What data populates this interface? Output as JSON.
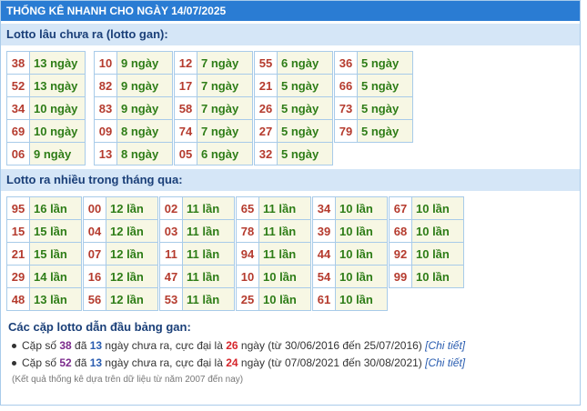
{
  "title": "THỐNG KÊ NHANH CHO NGÀY 14/07/2025",
  "gan": {
    "heading": "Lotto lâu chưa ra (lotto gan):",
    "columns": [
      [
        [
          "38",
          "13 ngày"
        ],
        [
          "52",
          "13 ngày"
        ],
        [
          "34",
          "10 ngày"
        ],
        [
          "69",
          "10 ngày"
        ],
        [
          "06",
          "9 ngày"
        ]
      ],
      [
        [
          "10",
          "9 ngày"
        ],
        [
          "82",
          "9 ngày"
        ],
        [
          "83",
          "9 ngày"
        ],
        [
          "09",
          "8 ngày"
        ],
        [
          "13",
          "8 ngày"
        ]
      ],
      [
        [
          "12",
          "7 ngày"
        ],
        [
          "17",
          "7 ngày"
        ],
        [
          "58",
          "7 ngày"
        ],
        [
          "74",
          "7 ngày"
        ],
        [
          "05",
          "6 ngày"
        ]
      ],
      [
        [
          "55",
          "6 ngày"
        ],
        [
          "21",
          "5 ngày"
        ],
        [
          "26",
          "5 ngày"
        ],
        [
          "27",
          "5 ngày"
        ],
        [
          "32",
          "5 ngày"
        ]
      ],
      [
        [
          "36",
          "5 ngày"
        ],
        [
          "66",
          "5 ngày"
        ],
        [
          "73",
          "5 ngày"
        ],
        [
          "79",
          "5 ngày"
        ]
      ]
    ]
  },
  "frequent": {
    "heading": "Lotto ra nhiều trong tháng qua:",
    "columns": [
      [
        [
          "95",
          "16 lần"
        ],
        [
          "15",
          "15 lần"
        ],
        [
          "21",
          "15 lần"
        ],
        [
          "29",
          "14 lần"
        ],
        [
          "48",
          "13 lần"
        ]
      ],
      [
        [
          "00",
          "12 lần"
        ],
        [
          "04",
          "12 lần"
        ],
        [
          "07",
          "12 lần"
        ],
        [
          "16",
          "12 lần"
        ],
        [
          "56",
          "12 lần"
        ]
      ],
      [
        [
          "02",
          "11 lần"
        ],
        [
          "03",
          "11 lần"
        ],
        [
          "11",
          "11 lần"
        ],
        [
          "47",
          "11 lần"
        ],
        [
          "53",
          "11 lần"
        ]
      ],
      [
        [
          "65",
          "11 lần"
        ],
        [
          "78",
          "11 lần"
        ],
        [
          "94",
          "11 lần"
        ],
        [
          "10",
          "10 lần"
        ],
        [
          "25",
          "10 lần"
        ]
      ],
      [
        [
          "34",
          "10 lần"
        ],
        [
          "39",
          "10 lần"
        ],
        [
          "44",
          "10 lần"
        ],
        [
          "54",
          "10 lần"
        ],
        [
          "61",
          "10 lần"
        ]
      ],
      [
        [
          "67",
          "10 lần"
        ],
        [
          "68",
          "10 lần"
        ],
        [
          "92",
          "10 lần"
        ],
        [
          "99",
          "10 lần"
        ]
      ]
    ]
  },
  "leaders": {
    "heading": "Các cặp lotto dẫn đầu bảng gan:",
    "items": [
      {
        "prefix": "Cặp số",
        "pair": "38",
        "mid1": "đã",
        "days": "13",
        "mid2": "ngày chưa ra, cực đại là",
        "max": "26",
        "suffix": "ngày (từ 30/06/2016 đến 25/07/2016)",
        "link": "[Chi tiết]"
      },
      {
        "prefix": "Cặp số",
        "pair": "52",
        "mid1": "đã",
        "days": "13",
        "mid2": "ngày chưa ra, cực đại là",
        "max": "24",
        "suffix": "ngày (từ 07/08/2021 đến 30/08/2021)",
        "link": "[Chi tiết]"
      }
    ],
    "note": "(Kết quả thống kê dựa trên dữ liệu từ năm 2007 đến nay)"
  }
}
